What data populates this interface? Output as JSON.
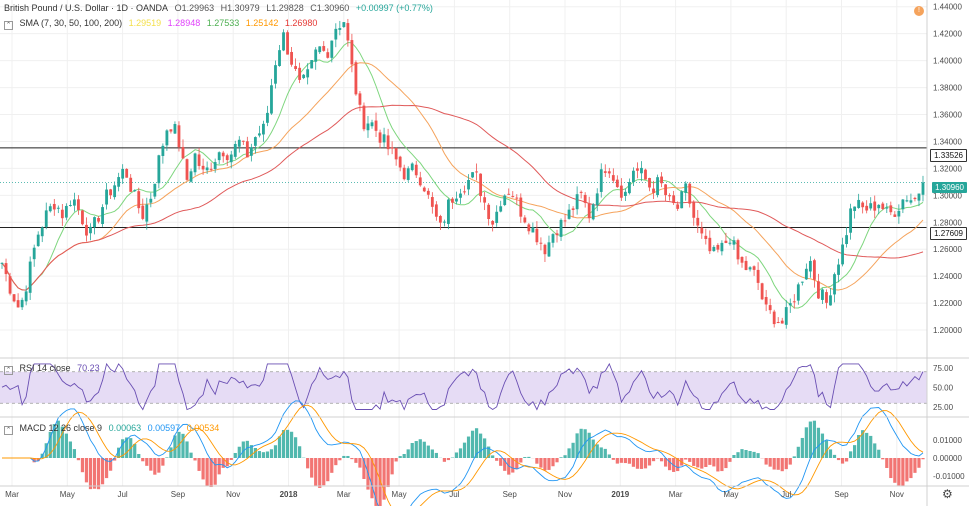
{
  "header": {
    "symbol": "British Pound / U.S. Dollar · 1D · OANDA",
    "open": "O1.29963",
    "high": "H1.30979",
    "low": "L1.29828",
    "close": "C1.30960",
    "change": "+0.00997 (+0.77%)"
  },
  "sma_legend": {
    "label": "SMA (7, 30, 50, 100, 200)",
    "values": [
      "1.29519",
      "1.28948",
      "1.27533",
      "1.25142",
      "1.26980"
    ],
    "colors": [
      "#f4e04d",
      "#e040fb",
      "#4caf50",
      "#ff9800",
      "#e53935"
    ]
  },
  "rsi_legend": {
    "label": "RSI 14 close",
    "value": "70.23"
  },
  "macd_legend": {
    "label": "MACD 12 26 close 9",
    "values": [
      "0.00063",
      "0.00597",
      "0.00534"
    ],
    "colors": [
      "#26a69a",
      "#2196f3",
      "#ff9800"
    ]
  },
  "price_labels": {
    "line_top": "1.33526",
    "current": "1.30960",
    "line_bottom": "1.27609"
  },
  "colors": {
    "up": "#26a69a",
    "down": "#ef5350",
    "sma50": "#7ed67e",
    "sma100": "#f5a35c",
    "sma200": "#e05a5a",
    "rsi": "#6a4fb3",
    "rsi_band": "#e6dcf5",
    "macd": "#2196f3",
    "signal": "#ff9800"
  },
  "chart_data": {
    "type": "candlestick",
    "y_ticks": [
      "1.44000",
      "1.42000",
      "1.40000",
      "1.38000",
      "1.36000",
      "1.34000",
      "1.32000",
      "1.30000",
      "1.28000",
      "1.26000",
      "1.24000",
      "1.22000",
      "1.20000"
    ],
    "ylim": [
      1.18,
      1.445
    ],
    "x_ticks": [
      "Mar",
      "May",
      "Jul",
      "Sep",
      "Nov",
      "2018",
      "Mar",
      "May",
      "Jul",
      "Sep",
      "Nov",
      "2019",
      "Mar",
      "May",
      "Jul",
      "Sep",
      "Nov"
    ],
    "horizontal_lines": [
      1.33526,
      1.27609
    ],
    "close_anchors": [
      1.25,
      1.23,
      1.215,
      1.24,
      1.27,
      1.285,
      1.295,
      1.285,
      1.3,
      1.285,
      1.27,
      1.285,
      1.3,
      1.31,
      1.32,
      1.3,
      1.285,
      1.3,
      1.33,
      1.355,
      1.345,
      1.31,
      1.33,
      1.315,
      1.325,
      1.335,
      1.33,
      1.34,
      1.33,
      1.345,
      1.35,
      1.395,
      1.42,
      1.4,
      1.38,
      1.39,
      1.41,
      1.405,
      1.425,
      1.43,
      1.39,
      1.355,
      1.355,
      1.345,
      1.335,
      1.325,
      1.315,
      1.32,
      1.31,
      1.29,
      1.275,
      1.295,
      1.305,
      1.31,
      1.315,
      1.295,
      1.28,
      1.3,
      1.305,
      1.29,
      1.28,
      1.27,
      1.26,
      1.275,
      1.28,
      1.29,
      1.3,
      1.285,
      1.31,
      1.325,
      1.31,
      1.3,
      1.32,
      1.315,
      1.305,
      1.31,
      1.295,
      1.29,
      1.305,
      1.28,
      1.265,
      1.255,
      1.26,
      1.27,
      1.25,
      1.245,
      1.24,
      1.215,
      1.21,
      1.205,
      1.22,
      1.235,
      1.255,
      1.23,
      1.22,
      1.245,
      1.265,
      1.295,
      1.29,
      1.29,
      1.295,
      1.285,
      1.29,
      1.3,
      1.296,
      1.3096
    ],
    "rsi": {
      "levels": [
        70,
        30
      ],
      "ticks": [
        "75.00",
        "50.00",
        "25.00"
      ],
      "current": 70.23
    },
    "macd": {
      "ticks": [
        "0.01000",
        "0.00000",
        "-0.01000"
      ],
      "macd": 0.00063,
      "signal": 0.00597,
      "hist": 0.00534
    }
  }
}
